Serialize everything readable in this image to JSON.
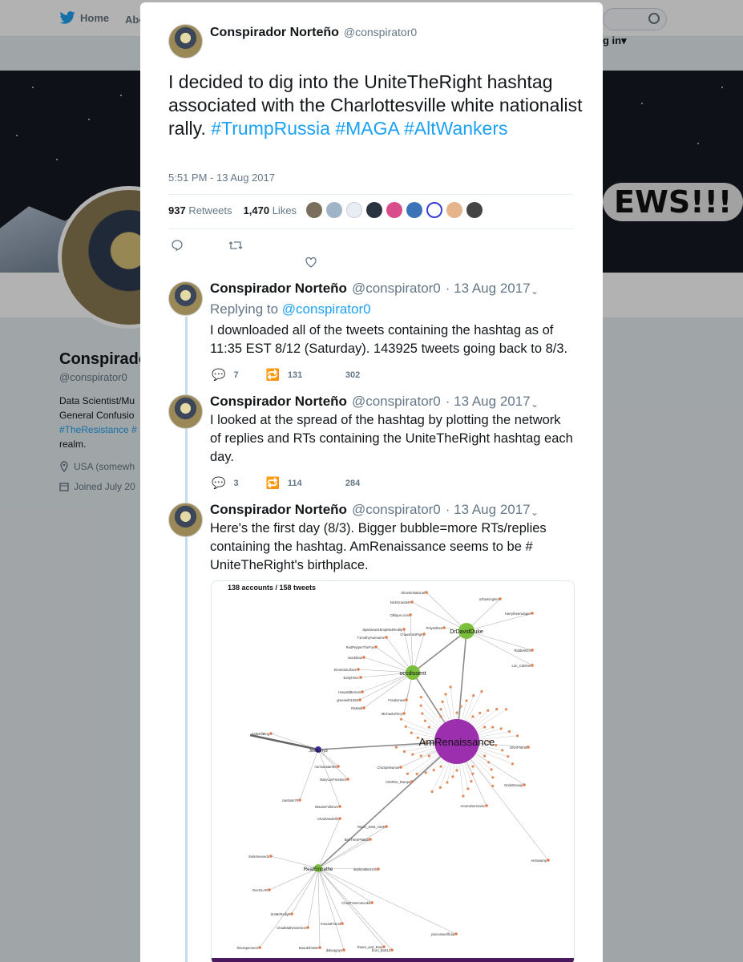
{
  "background": {
    "nav": {
      "home": "Home",
      "about": "Abo",
      "login": "g in"
    },
    "banner_text": "EWS!!!",
    "profile": {
      "name": "Conspirado",
      "handle": "@conspirator0",
      "bio_lines": [
        "Data Scientist/Mu",
        "General Confusio",
        "#TheResistance #",
        "realm."
      ],
      "location": "USA (somewh",
      "joined": "Joined July 20"
    }
  },
  "main_tweet": {
    "name": "Conspirador Norteño",
    "handle": "@conspirator0",
    "text": "I decided to dig into the UniteTheRight hashtag associated with the Charlottesville white nationalist rally.",
    "hashtags": "#TrumpRussia #MAGA #AltWankers",
    "time": "5:51 PM - 13 Aug 2017",
    "retweets": "937",
    "retweets_label": "Retweets",
    "likes": "1,470",
    "likes_label": "Likes"
  },
  "replies": [
    {
      "name": "Conspirador Norteño",
      "handle": "@conspirator0",
      "date": "· 13 Aug 2017",
      "replying_prefix": "Replying to",
      "replying_to": "@conspirator0",
      "text": "I downloaded all of the tweets containing the hashtag as of 11:35 EST 8/12 (Saturday).  143925 tweets going back to 8/3.",
      "reply_count": "7",
      "retweet_count": "131",
      "like_count": "302"
    },
    {
      "name": "Conspirador Norteño",
      "handle": "@conspirator0",
      "date": "· 13 Aug 2017",
      "text": "I looked at the spread of the hashtag by plotting the network of replies and RTs containing the UniteTheRight hashtag each day.",
      "reply_count": "3",
      "retweet_count": "114",
      "like_count": "284"
    },
    {
      "name": "Conspirador Norteño",
      "handle": "@conspirator0",
      "date": "· 13 Aug 2017",
      "text": "Here's the first day (8/3).  Bigger bubble=more RTs/replies containing the hashtag.  AmRenaissance seems to be # UniteTheRight's birthplace."
    }
  ],
  "graph": {
    "caption": "138 accounts / 158 tweets",
    "hub_labels": [
      "AmRenaissance",
      "DrDavidDuke",
      "occdissent",
      "JimMurry3",
      "RealEmpathe"
    ],
    "leaf_labels": [
      "ShoebeNational",
      "NickGrandeR",
      "Oblique.com",
      "Spartanus4EmpMe4Really",
      "T1mothyAwesome",
      "RedPepperTheFox",
      "wordsfaul",
      "KimonsSurface",
      "EarlyHISC",
      "HowardBernon",
      "greeneith1084",
      "Ratwall",
      "KaltyEllBlog",
      "normanstanlev",
      "MaryLuvFreedom",
      "ciantiam78",
      "IntsaneFolklove",
      "ChadVandell4",
      "Reich_1933_1945",
      "BenTheSPNBall",
      "EvileSeeved4",
      "DocOLAR",
      "JimMcReilly8",
      "ChadMathenderson",
      "FascistFriend",
      "ChadTHeHomunkk",
      "deplorableizzch",
      "thresspenners",
      "BoardsforMe",
      "dsbeagoys",
      "Roam_and_Row",
      "Euro_Bott14",
      "processeofficial",
      "AHSwamp",
      "ozhamingher",
      "Harrytheerwinger",
      "RiddeMOS",
      "Lon_Cdekns",
      "PolysSlkes",
      "ChauvinistPigs",
      "Frankonew",
      "MichaelaTlery",
      "ChuSpelearow",
      "CDIRtor_Ramps",
      "AmeraGermanic",
      "DNAFriend",
      "GodoDeway"
    ]
  }
}
